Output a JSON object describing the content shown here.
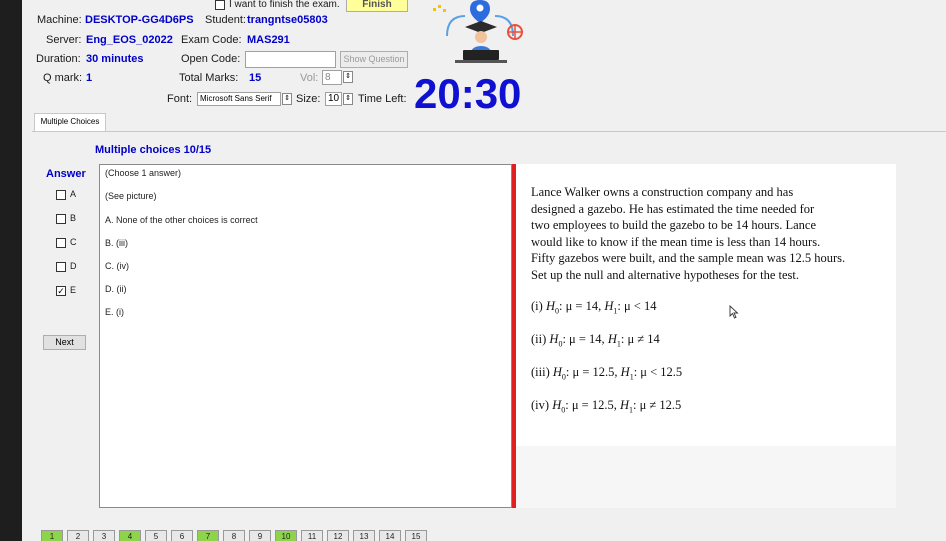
{
  "header": {
    "finish_checkbox_label": "I want to finish the exam.",
    "finish_button": "Finish",
    "machine_label": "Machine:",
    "machine_value": "DESKTOP-GG4D6PS",
    "student_label": "Student:",
    "student_value": "trangntse05803",
    "server_label": "Server:",
    "server_value": "Eng_EOS_02022",
    "exam_code_label": "Exam Code:",
    "exam_code_value": "MAS291",
    "duration_label": "Duration:",
    "duration_value": "30 minutes",
    "open_code_label": "Open Code:",
    "open_code_value": "",
    "show_question_button": "Show Question",
    "qmark_label": "Q mark:",
    "qmark_value": "1",
    "total_marks_label": "Total Marks:",
    "total_marks_value": "15",
    "vol_label": "Vol:",
    "vol_value": "8",
    "font_label": "Font:",
    "font_value": "Microsoft Sans Serif",
    "size_label": "Size:",
    "size_value": "10",
    "time_left_label": "Time Left:",
    "time_left_value": "20:30"
  },
  "tab": {
    "label": "Multiple Choices"
  },
  "question": {
    "header": "Multiple choices 10/15",
    "answer_label": "Answer",
    "options": [
      {
        "label": "A",
        "checked": false
      },
      {
        "label": "B",
        "checked": false
      },
      {
        "label": "C",
        "checked": false
      },
      {
        "label": "D",
        "checked": false
      },
      {
        "label": "E",
        "checked": true
      }
    ],
    "next_button": "Next",
    "choice_lines": [
      "(Choose 1 answer)",
      "(See picture)",
      "A. None of the other choices is correct",
      "B. (iii)",
      "C. (iv)",
      "D. (ii)",
      "E. (i)"
    ],
    "picture": {
      "paragraph_lines": [
        "Lance Walker owns a construction company and has",
        "designed a gazebo. He has estimated the time needed for",
        "two employees to build the gazebo to be 14 hours. Lance",
        "would like to know if the mean time is less than 14 hours.",
        "Fifty gazebos were built, and the sample mean was 12.5 hours.",
        "Set up the null and alternative hypotheses for the test."
      ],
      "hypotheses": [
        {
          "num": "(i)",
          "h0_value": "μ = 14,",
          "h1_value": "μ < 14"
        },
        {
          "num": "(ii)",
          "h0_value": "μ = 14,",
          "h1_value": "μ ≠ 14"
        },
        {
          "num": "(iii)",
          "h0_value": "μ = 12.5,",
          "h1_value": "μ < 12.5"
        },
        {
          "num": "(iv)",
          "h0_value": "μ = 12.5,",
          "h1_value": "μ ≠ 12.5"
        }
      ],
      "h0_symbol": "H",
      "h0_sub": "0",
      "h1_symbol": "H",
      "h1_sub": "1"
    }
  },
  "pagination": {
    "pages": [
      {
        "num": "1",
        "answered": true
      },
      {
        "num": "2",
        "answered": false
      },
      {
        "num": "3",
        "answered": false
      },
      {
        "num": "4",
        "answered": true
      },
      {
        "num": "5",
        "answered": false
      },
      {
        "num": "6",
        "answered": false
      },
      {
        "num": "7",
        "answered": true
      },
      {
        "num": "8",
        "answered": false
      },
      {
        "num": "9",
        "answered": false
      },
      {
        "num": "10",
        "answered": true
      },
      {
        "num": "11",
        "answered": false
      },
      {
        "num": "12",
        "answered": false
      },
      {
        "num": "13",
        "answered": false
      },
      {
        "num": "14",
        "answered": false
      },
      {
        "num": "15",
        "answered": false
      }
    ]
  },
  "colors": {
    "accent_blue": "#0000c8",
    "timer_blue": "#1010d0",
    "finish_yellow": "#ffff99",
    "divider_red": "#e02020",
    "answered_green": "#8ed44a"
  },
  "icons": {
    "logo": "graduate-laptop-illustration",
    "cursor": "mouse-pointer-icon"
  }
}
